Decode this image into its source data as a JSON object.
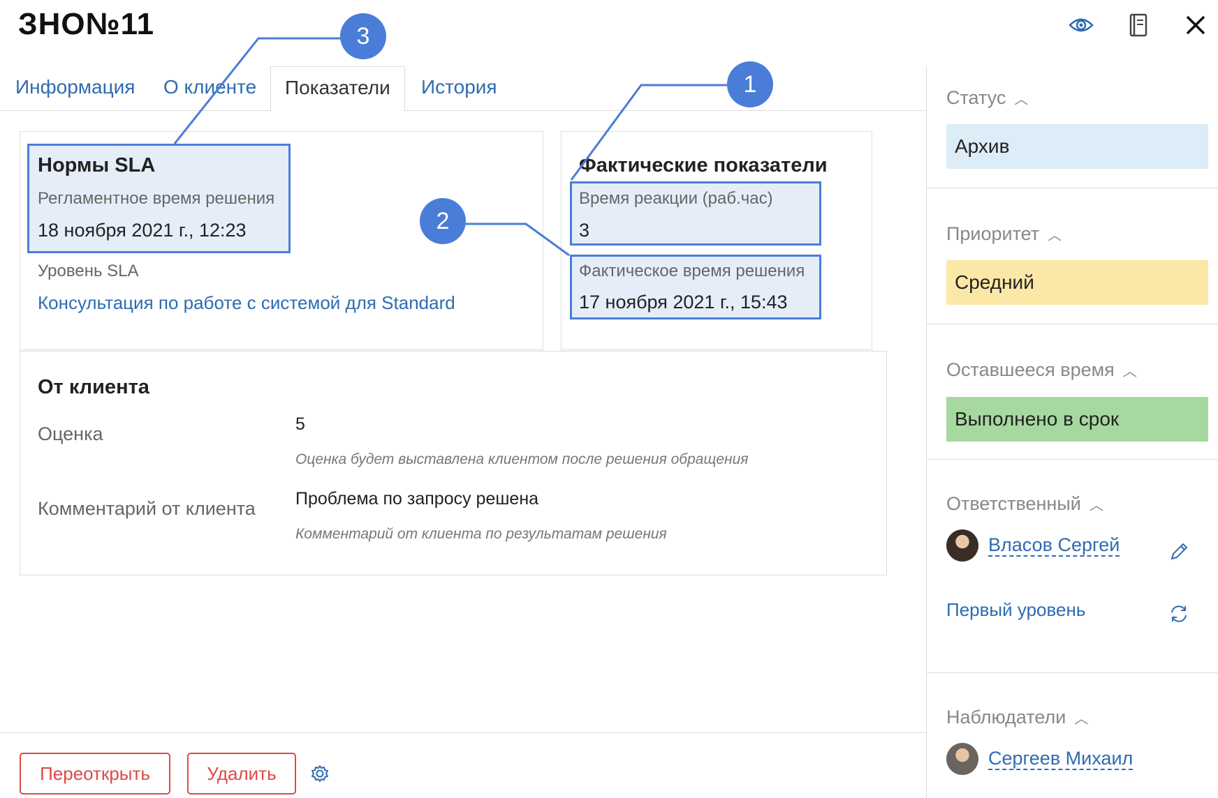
{
  "header": {
    "title": "ЗНО№11",
    "icons": [
      "eye-icon",
      "book-icon",
      "close-icon"
    ]
  },
  "tabs": [
    {
      "label": "Информация",
      "active": false
    },
    {
      "label": "О клиенте",
      "active": false
    },
    {
      "label": "Показатели",
      "active": true
    },
    {
      "label": "История",
      "active": false
    }
  ],
  "sla": {
    "title": "Нормы SLA",
    "deadline_label": "Регламентное время решения",
    "deadline_value": "18 ноября 2021 г., 12:23",
    "level_label": "Уровень SLA",
    "level_value": "Консультация по работе с системой для Standard"
  },
  "actual": {
    "title": "Фактические показатели",
    "reaction_label": "Время реакции (раб.час)",
    "reaction_value": "3",
    "resolution_label": "Фактическое время решения",
    "resolution_value": "17 ноября 2021 г., 15:43"
  },
  "client": {
    "title": "От клиента",
    "rating_label": "Оценка",
    "rating_value": "5",
    "rating_hint": "Оценка будет выставлена клиентом после решения обращения",
    "comment_label": "Комментарий от клиента",
    "comment_value": "Проблема по запросу решена",
    "comment_hint": "Комментарий от клиента по результатам решения"
  },
  "callouts": [
    "1",
    "2",
    "3"
  ],
  "sidebar": {
    "status": {
      "label": "Статус",
      "value": "Архив",
      "color": "#dcedf7"
    },
    "priority": {
      "label": "Приоритет",
      "value": "Средний",
      "color": "#fbe8a6"
    },
    "remaining": {
      "label": "Оставшееся время",
      "value": "Выполнено в срок",
      "color": "#a6d99f"
    },
    "responsible": {
      "label": "Ответственный",
      "person": "Власов Сергей",
      "group": "Первый уровень"
    },
    "watchers": {
      "label": "Наблюдатели",
      "person": "Сергеев Михаил"
    }
  },
  "footer": {
    "reopen_label": "Переоткрыть",
    "delete_label": "Удалить"
  },
  "colors": {
    "accent": "#4a7dd8",
    "link": "#2f6bb0",
    "danger": "#e04848"
  }
}
